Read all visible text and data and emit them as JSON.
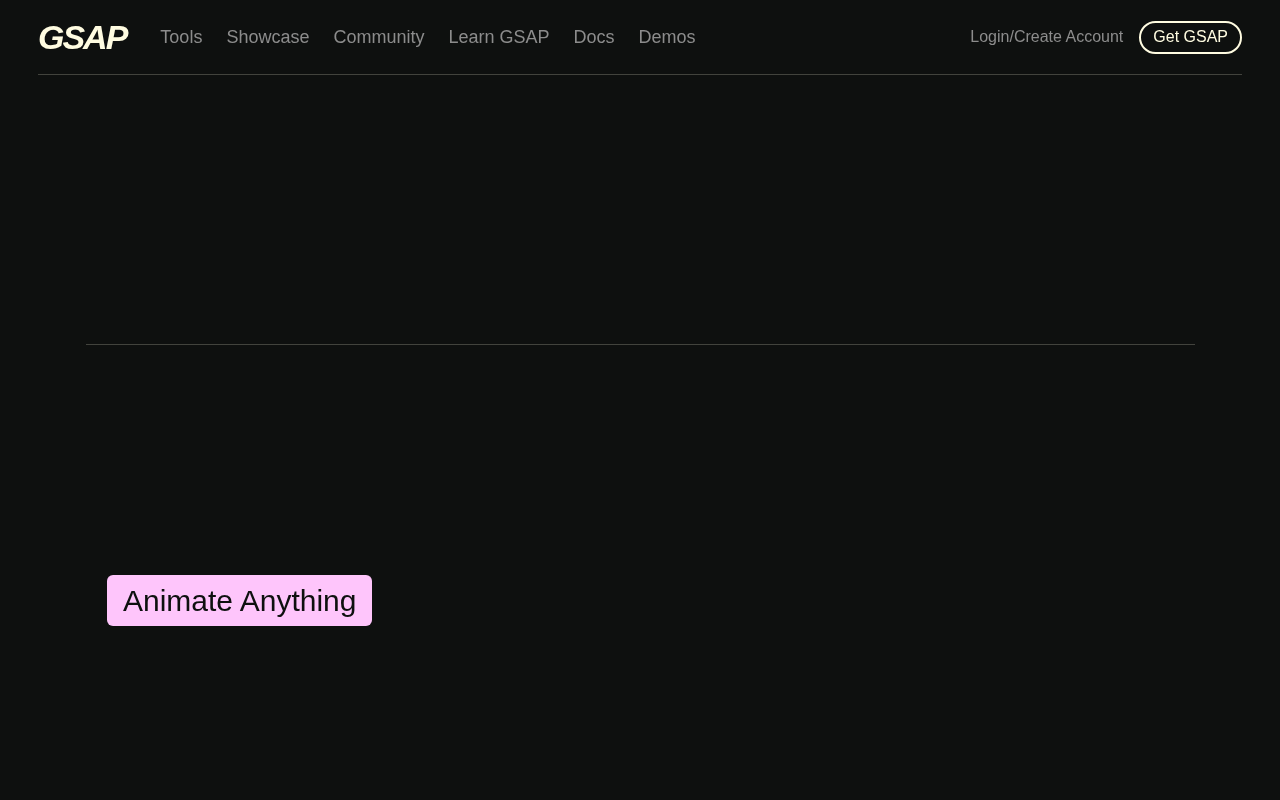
{
  "header": {
    "logo": "GSAP",
    "nav": [
      {
        "label": "Tools"
      },
      {
        "label": "Showcase"
      },
      {
        "label": "Community"
      },
      {
        "label": "Learn GSAP"
      },
      {
        "label": "Docs"
      },
      {
        "label": "Demos"
      }
    ],
    "login": "Login/Create Account",
    "cta": "Get GSAP"
  },
  "tag": "Animate Anything"
}
